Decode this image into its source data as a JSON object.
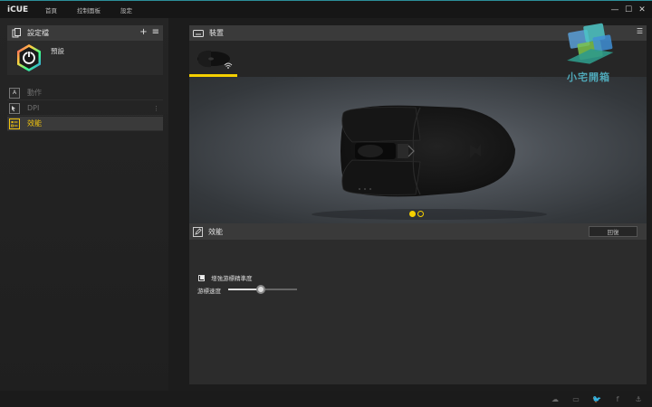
{
  "app": {
    "name": "iCUE"
  },
  "nav": {
    "items": [
      {
        "label": "首頁"
      },
      {
        "label": "控制面板"
      },
      {
        "label": "設定"
      }
    ]
  },
  "window": {
    "minimize_icon": "minimize-icon",
    "maximize_icon": "maximize-icon",
    "close_icon": "close-icon"
  },
  "profiles": {
    "title": "設定檔",
    "add_icon": "plus-icon",
    "menu_icon": "menu-icon",
    "current": {
      "name": "預設"
    }
  },
  "actions": {
    "items": [
      {
        "label": "動作",
        "icon_text": "A",
        "active": false
      },
      {
        "label": "DPI",
        "icon_text": "",
        "active": false
      },
      {
        "label": "效能",
        "icon_text": "",
        "active": true
      }
    ]
  },
  "devices": {
    "title": "裝置",
    "active_index": 0,
    "pages": 2
  },
  "watermark": {
    "text": "小宅開箱"
  },
  "performance": {
    "title": "效能",
    "reset_label": "回復",
    "enhance_precision": {
      "label": "增強游標精準度",
      "checked": true
    },
    "pointer_speed": {
      "label": "游標速度",
      "value": 0.47
    }
  },
  "accent": "#f5d000"
}
